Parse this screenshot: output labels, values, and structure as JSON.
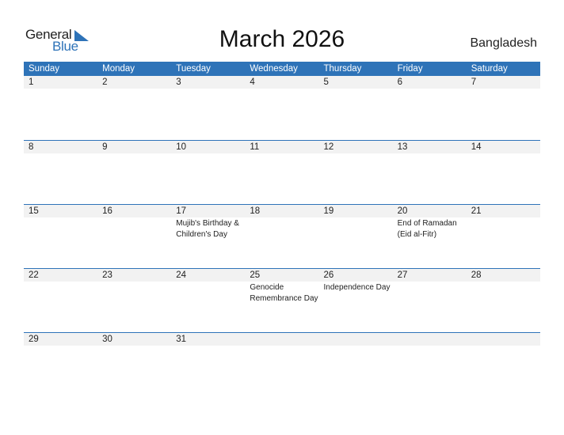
{
  "logo": {
    "general": "General",
    "blue": "Blue"
  },
  "title": "March 2026",
  "country": "Bangladesh",
  "colors": {
    "accent": "#2e73b8",
    "date_strip": "#f2f2f2"
  },
  "weekdays": [
    "Sunday",
    "Monday",
    "Tuesday",
    "Wednesday",
    "Thursday",
    "Friday",
    "Saturday"
  ],
  "weeks": [
    {
      "days": [
        "1",
        "2",
        "3",
        "4",
        "5",
        "6",
        "7"
      ],
      "events": [
        "",
        "",
        "",
        "",
        "",
        "",
        ""
      ]
    },
    {
      "days": [
        "8",
        "9",
        "10",
        "11",
        "12",
        "13",
        "14"
      ],
      "events": [
        "",
        "",
        "",
        "",
        "",
        "",
        ""
      ]
    },
    {
      "days": [
        "15",
        "16",
        "17",
        "18",
        "19",
        "20",
        "21"
      ],
      "events": [
        "",
        "",
        "Mujib's Birthday & Children's Day",
        "",
        "",
        "End of Ramadan (Eid al-Fitr)",
        ""
      ]
    },
    {
      "days": [
        "22",
        "23",
        "24",
        "25",
        "26",
        "27",
        "28"
      ],
      "events": [
        "",
        "",
        "",
        "Genocide Remembrance Day",
        "Independence Day",
        "",
        ""
      ]
    },
    {
      "days": [
        "29",
        "30",
        "31",
        "",
        "",
        "",
        ""
      ],
      "events": [
        "",
        "",
        "",
        "",
        "",
        "",
        ""
      ]
    }
  ]
}
